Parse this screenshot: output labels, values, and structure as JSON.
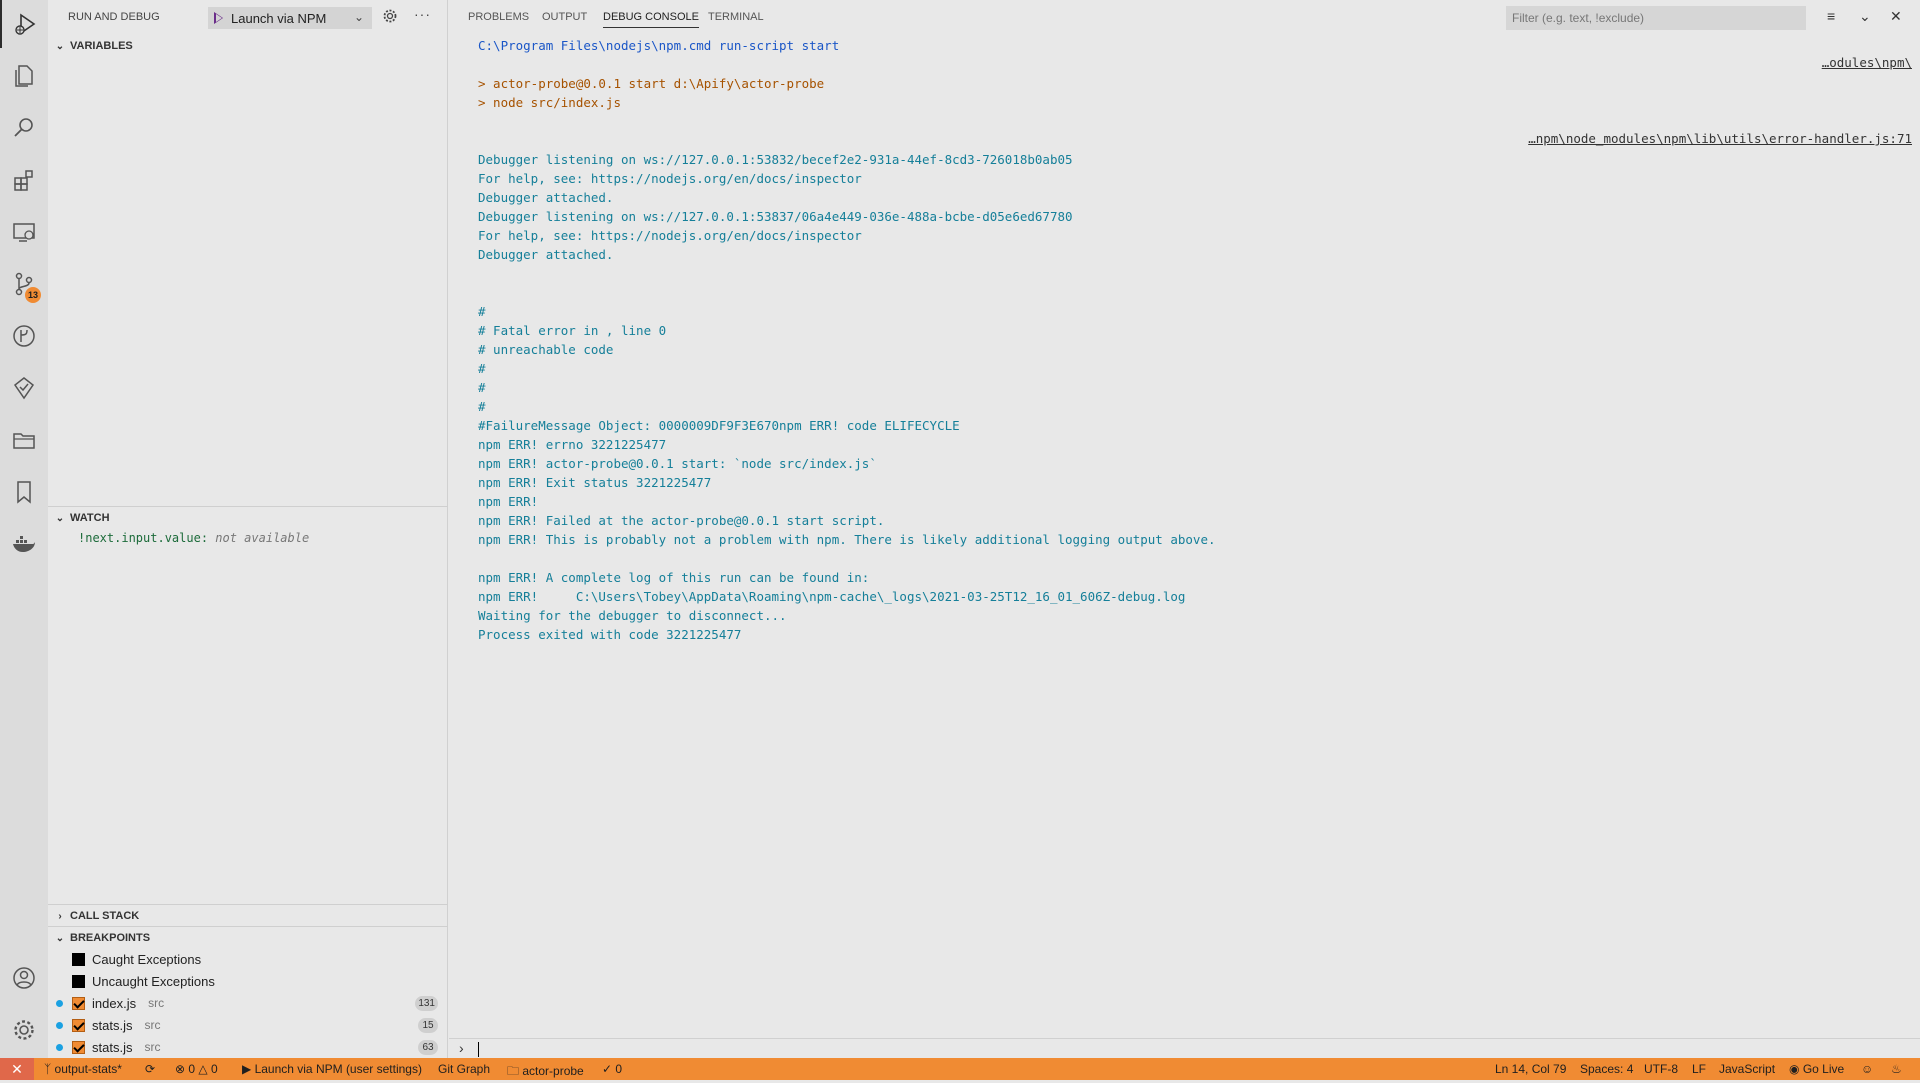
{
  "activity_bar": {
    "icons": [
      "run-debug-icon",
      "explorer-icon",
      "search-icon",
      "extensions-icon",
      "remote-explorer-icon",
      "source-control-icon",
      "git-graph-icon",
      "testing-icon",
      "project-manager-icon",
      "bookmarks-icon",
      "docker-icon",
      "accounts-icon",
      "settings-icon"
    ],
    "source_control_badge": "13"
  },
  "sidebar": {
    "title": "RUN AND DEBUG",
    "launch_config": "Launch via NPM",
    "sections": {
      "variables": "VARIABLES",
      "watch": "WATCH",
      "call_stack": "CALL STACK",
      "breakpoints": "BREAKPOINTS"
    },
    "watch_items": [
      {
        "name": "!next.input.value:",
        "value": "not available"
      }
    ],
    "breakpoints": [
      {
        "label": "Caught Exceptions",
        "checked": false
      },
      {
        "label": "Uncaught Exceptions",
        "checked": false
      },
      {
        "label": "index.js",
        "path": "src",
        "line": "131",
        "checked": true
      },
      {
        "label": "stats.js",
        "path": "src",
        "line": "15",
        "checked": true
      },
      {
        "label": "stats.js",
        "path": "src",
        "line": "63",
        "checked": true
      }
    ]
  },
  "panel": {
    "tabs": [
      "PROBLEMS",
      "OUTPUT",
      "DEBUG CONSOLE",
      "TERMINAL"
    ],
    "active_tab": "DEBUG CONSOLE",
    "filter_placeholder": "Filter (e.g. text, !exclude)",
    "source_refs": [
      "…odules\\npm\\",
      "…npm\\node_modules\\npm\\lib\\utils\\error-handler.js:71"
    ],
    "console_lines": [
      {
        "text": "C:\\Program Files\\nodejs\\npm.cmd run-script start",
        "color": "blue"
      },
      {
        "text": "",
        "color": "teal"
      },
      {
        "text": "> actor-probe@0.0.1 start d:\\Apify\\actor-probe",
        "color": "orange"
      },
      {
        "text": "> node src/index.js",
        "color": "orange"
      },
      {
        "text": "",
        "color": "teal"
      },
      {
        "text": "",
        "color": "teal"
      },
      {
        "text": "Debugger listening on ws://127.0.0.1:53832/becef2e2-931a-44ef-8cd3-726018b0ab05",
        "color": "teal"
      },
      {
        "text": "For help, see: https://nodejs.org/en/docs/inspector",
        "color": "teal"
      },
      {
        "text": "Debugger attached.",
        "color": "teal"
      },
      {
        "text": "Debugger listening on ws://127.0.0.1:53837/06a4e449-036e-488a-bcbe-d05e6ed67780",
        "color": "teal"
      },
      {
        "text": "For help, see: https://nodejs.org/en/docs/inspector",
        "color": "teal"
      },
      {
        "text": "Debugger attached.",
        "color": "teal"
      },
      {
        "text": "",
        "color": "teal"
      },
      {
        "text": "",
        "color": "teal"
      },
      {
        "text": "#",
        "color": "teal"
      },
      {
        "text": "# Fatal error in , line 0",
        "color": "teal"
      },
      {
        "text": "# unreachable code",
        "color": "teal"
      },
      {
        "text": "#",
        "color": "teal"
      },
      {
        "text": "#",
        "color": "teal"
      },
      {
        "text": "#",
        "color": "teal"
      },
      {
        "text": "#FailureMessage Object: 0000009DF9F3E670npm ERR! code ELIFECYCLE",
        "color": "teal"
      },
      {
        "text": "npm ERR! errno 3221225477",
        "color": "teal"
      },
      {
        "text": "npm ERR! actor-probe@0.0.1 start: `node src/index.js`",
        "color": "teal"
      },
      {
        "text": "npm ERR! Exit status 3221225477",
        "color": "teal"
      },
      {
        "text": "npm ERR!",
        "color": "teal"
      },
      {
        "text": "npm ERR! Failed at the actor-probe@0.0.1 start script.",
        "color": "teal"
      },
      {
        "text": "npm ERR! This is probably not a problem with npm. There is likely additional logging output above.",
        "color": "teal"
      },
      {
        "text": "",
        "color": "teal"
      },
      {
        "text": "npm ERR! A complete log of this run can be found in:",
        "color": "teal"
      },
      {
        "text": "npm ERR!     C:\\Users\\Tobey\\AppData\\Roaming\\npm-cache\\_logs\\2021-03-25T12_16_01_606Z-debug.log",
        "color": "teal"
      },
      {
        "text": "Waiting for the debugger to disconnect...",
        "color": "teal"
      },
      {
        "text": "Process exited with code 3221225477",
        "color": "teal"
      }
    ]
  },
  "status_bar": {
    "branch": "output-stats*",
    "problems": "0",
    "warnings": "0",
    "debug_config": "Launch via NPM (user settings)",
    "git_graph": "Git Graph",
    "folder": "actor-probe",
    "check_count": "0",
    "cursor": "Ln 14, Col 79",
    "spaces": "Spaces: 4",
    "encoding": "UTF-8",
    "eol": "LF",
    "language": "JavaScript",
    "go_live": "Go Live"
  },
  "colors": {
    "status_bar": "#f08b33",
    "console_blue": "#1a56c7",
    "console_orange": "#a65200",
    "console_teal": "#157f99",
    "breakpoint_dot": "#1ba1e2"
  }
}
